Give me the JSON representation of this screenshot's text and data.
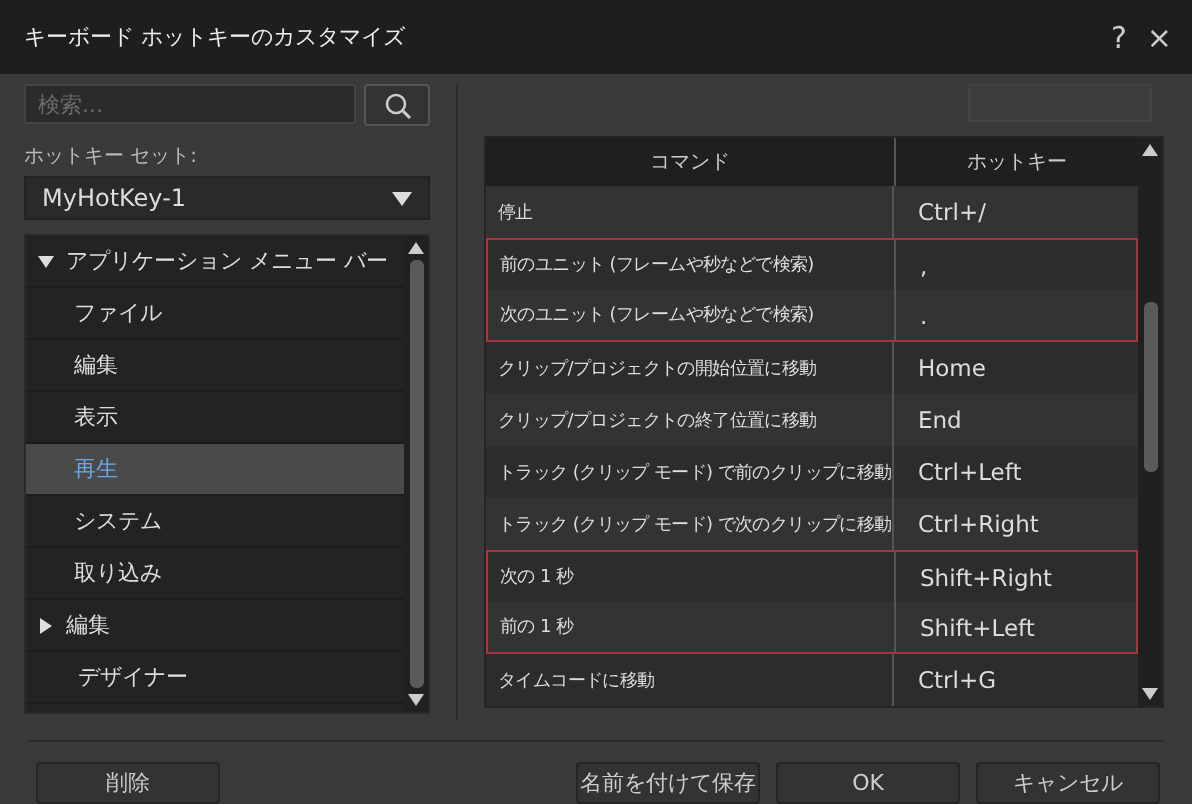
{
  "window": {
    "title": "キーボード ホットキーのカスタマイズ",
    "help": "?",
    "close": "×"
  },
  "search": {
    "placeholder": "検索..."
  },
  "hotkey_set": {
    "label": "ホットキー セット:",
    "value": "MyHotKey-1"
  },
  "tree": [
    {
      "label": "アプリケーション メニュー バー",
      "expanded": true,
      "selected": false,
      "children": [
        {
          "label": "ファイル",
          "selected": false
        },
        {
          "label": "編集",
          "selected": false
        },
        {
          "label": "表示",
          "selected": false
        },
        {
          "label": "再生",
          "selected": true
        },
        {
          "label": "システム",
          "selected": false
        },
        {
          "label": "取り込み",
          "selected": false
        }
      ]
    },
    {
      "label": "編集",
      "expanded": false,
      "selected": false
    },
    {
      "label": "デザイナー",
      "selected": false
    }
  ],
  "table": {
    "columns": [
      "コマンド",
      "ホットキー"
    ],
    "rows": [
      {
        "command": "停止",
        "hotkey": "Ctrl+/",
        "marked": false
      },
      {
        "command": "前のユニット (フレームや秒などで検索)",
        "hotkey": ",",
        "marked": true
      },
      {
        "command": "次のユニット (フレームや秒などで検索)",
        "hotkey": ".",
        "marked": true
      },
      {
        "command": "クリップ/プロジェクトの開始位置に移動",
        "hotkey": "Home",
        "marked": false
      },
      {
        "command": "クリップ/プロジェクトの終了位置に移動",
        "hotkey": "End",
        "marked": false
      },
      {
        "command": "トラック (クリップ モード) で前のクリップに移動",
        "hotkey": "Ctrl+Left",
        "marked": false
      },
      {
        "command": "トラック (クリップ モード) で次のクリップに移動",
        "hotkey": "Ctrl+Right",
        "marked": false
      },
      {
        "command": "次の 1 秒",
        "hotkey": "Shift+Right",
        "marked": true
      },
      {
        "command": "前の 1 秒",
        "hotkey": "Shift+Left",
        "marked": true
      },
      {
        "command": "タイムコードに移動",
        "hotkey": "Ctrl+G",
        "marked": false
      }
    ]
  },
  "buttons": {
    "delete": "削除",
    "save_as": "名前を付けて保存",
    "ok": "OK",
    "cancel": "キャンセル"
  }
}
